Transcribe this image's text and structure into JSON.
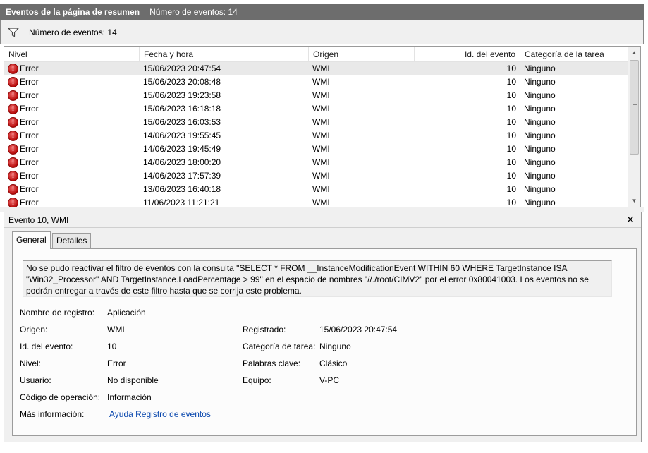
{
  "titlebar": {
    "title": "Eventos de la página de resumen",
    "count_text": "Número de eventos: 14"
  },
  "filterbar": {
    "icon": "filter-icon",
    "text": "Número de eventos: 14"
  },
  "grid": {
    "columns": [
      "Nivel",
      "Fecha y hora",
      "Origen",
      "Id. del evento",
      "Categoría de la tarea"
    ],
    "rows": [
      {
        "level": "Error",
        "date": "15/06/2023 20:47:54",
        "source": "WMI",
        "id": "10",
        "category": "Ninguno"
      },
      {
        "level": "Error",
        "date": "15/06/2023 20:08:48",
        "source": "WMI",
        "id": "10",
        "category": "Ninguno"
      },
      {
        "level": "Error",
        "date": "15/06/2023 19:23:58",
        "source": "WMI",
        "id": "10",
        "category": "Ninguno"
      },
      {
        "level": "Error",
        "date": "15/06/2023 16:18:18",
        "source": "WMI",
        "id": "10",
        "category": "Ninguno"
      },
      {
        "level": "Error",
        "date": "15/06/2023 16:03:53",
        "source": "WMI",
        "id": "10",
        "category": "Ninguno"
      },
      {
        "level": "Error",
        "date": "14/06/2023 19:55:45",
        "source": "WMI",
        "id": "10",
        "category": "Ninguno"
      },
      {
        "level": "Error",
        "date": "14/06/2023 19:45:49",
        "source": "WMI",
        "id": "10",
        "category": "Ninguno"
      },
      {
        "level": "Error",
        "date": "14/06/2023 18:00:20",
        "source": "WMI",
        "id": "10",
        "category": "Ninguno"
      },
      {
        "level": "Error",
        "date": "14/06/2023 17:57:39",
        "source": "WMI",
        "id": "10",
        "category": "Ninguno"
      },
      {
        "level": "Error",
        "date": "13/06/2023 16:40:18",
        "source": "WMI",
        "id": "10",
        "category": "Ninguno"
      },
      {
        "level": "Error",
        "date": "11/06/2023 11:21:21",
        "source": "WMI",
        "id": "10",
        "category": "Ninguno"
      }
    ],
    "level_icon": "error-icon",
    "selected_row": 0
  },
  "detail": {
    "header": "Evento 10, WMI",
    "close_icon": "close-icon",
    "tabs": [
      "General",
      "Detalles"
    ],
    "active_tab": "General",
    "description": "No se pudo reactivar el filtro de eventos con la consulta \"SELECT * FROM __InstanceModificationEvent WITHIN 60 WHERE TargetInstance ISA \"Win32_Processor\" AND TargetInstance.LoadPercentage > 99\" en el espacio de nombres \"//./root/CIMV2\" por el error 0x80041003. Los eventos no se podrán entregar a través de este filtro hasta que se corrija este problema.",
    "fields": {
      "log_name_label": "Nombre de registro:",
      "log_name": "Aplicación",
      "source_label": "Origen:",
      "source": "WMI",
      "logged_label": "Registrado:",
      "logged": "15/06/2023 20:47:54",
      "event_id_label": "Id. del evento:",
      "event_id": "10",
      "task_category_label": "Categoría de tarea:",
      "task_category": "Ninguno",
      "level_label": "Nivel:",
      "level": "Error",
      "keywords_label": "Palabras clave:",
      "keywords": "Clásico",
      "user_label": "Usuario:",
      "user": "No disponible",
      "computer_label": "Equipo:",
      "computer": "V-PC",
      "opcode_label": "Código de operación:",
      "opcode": "Información",
      "more_info_label": "Más información:",
      "more_info_link": "Ayuda Registro de eventos"
    }
  }
}
